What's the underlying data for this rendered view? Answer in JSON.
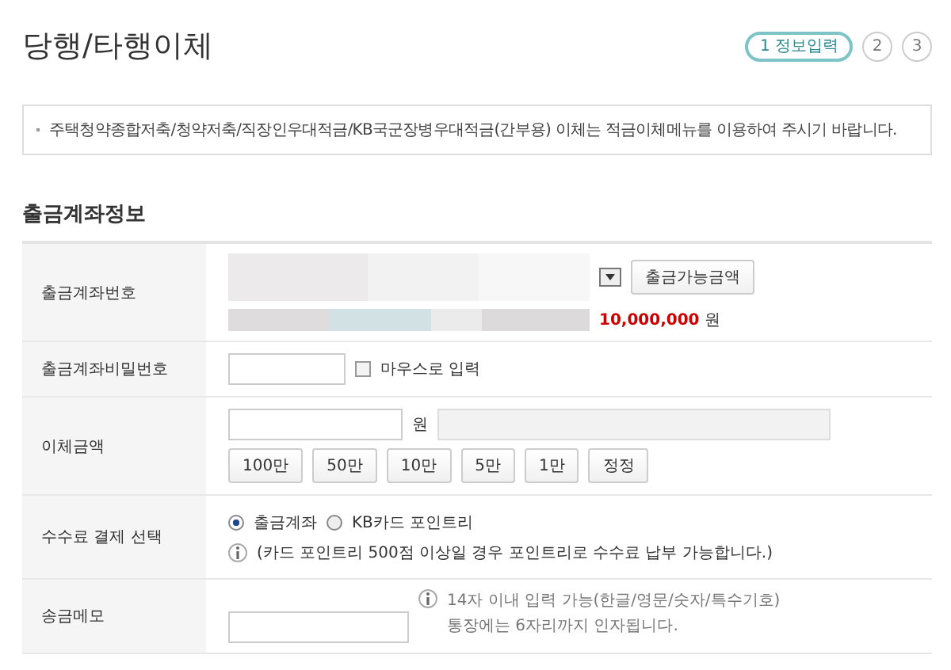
{
  "page_title": "당행/타행이체",
  "steps": [
    {
      "label": "1 정보입력",
      "selected": true
    },
    {
      "label": "2",
      "selected": false
    },
    {
      "label": "3",
      "selected": false
    }
  ],
  "notice": "주택청약종합저축/청약저축/직장인우대적금/KB국군장병우대적금(간부용) 이체는 적금이체메뉴를 이용하여 주시기 바랍니다.",
  "section_title": "출금계좌정보",
  "rows": [
    {
      "kind": "account",
      "label": "출금계좌번호",
      "button": "출금가능금액",
      "balance": "10,000,000",
      "unit": "원"
    },
    {
      "kind": "password",
      "label": "출금계좌비밀번호",
      "checkbox": {
        "label": "마우스로 입력",
        "checked": false
      }
    },
    {
      "kind": "amount",
      "label": "이체금액",
      "unit": "원",
      "buttons": [
        "100만",
        "50만",
        "10만",
        "5만",
        "1만",
        "정정"
      ]
    },
    {
      "kind": "fee",
      "label": "수수료 결제 선택",
      "options": [
        {
          "label": "출금계좌",
          "selected": true
        },
        {
          "label": "KB카드 포인트리",
          "selected": false
        }
      ],
      "info": "(카드 포인트리 500점 이상일 경우 포인트리로 수수료 납부 가능합니다.)"
    },
    {
      "kind": "memo",
      "label": "송금메모",
      "info": [
        "14자 이내 입력 가능(한글/영문/숫자/특수기호)",
        "통장에는 6자리까지 인자됩니다."
      ]
    }
  ]
}
